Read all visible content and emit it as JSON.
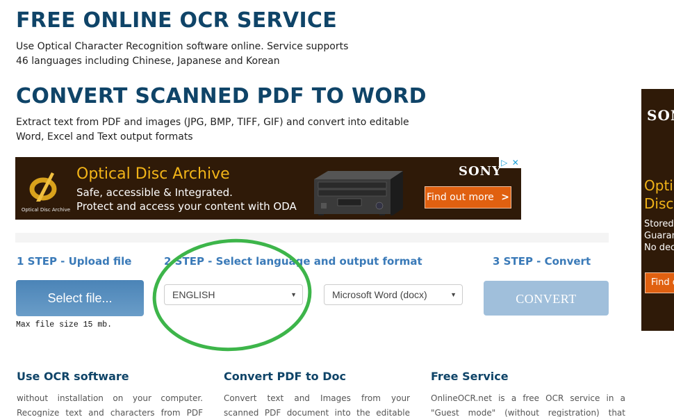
{
  "header": {
    "title": "FREE ONLINE OCR SERVICE",
    "description_lines": [
      "Use Optical Character Recognition software online. Service supports",
      "46 languages including Chinese, Japanese and Korean"
    ],
    "subtitle": "CONVERT SCANNED PDF TO WORD",
    "subdescription_lines": [
      "Extract text from PDF and images (JPG, BMP, TIFF, GIF) and convert into editable",
      "Word, Excel and Text output formats"
    ]
  },
  "ad_banner": {
    "logo_text": "Optical Disc Archive",
    "title": "Optical Disc Archive",
    "line1": "Safe, accessible & Integrated.",
    "line2": "Protect and access your content with ODA",
    "brand": "SONY",
    "cta": "Find out more",
    "cta_chevron": ">",
    "adchoices_play": "▷",
    "adchoices_close": "✕",
    "colors": {
      "background": "#2f1a08",
      "title": "#f2b418",
      "cta": "#e06010"
    }
  },
  "side_ad": {
    "brand": "SONY",
    "title_lines": [
      "Optical",
      "Disc"
    ],
    "lines": [
      "Stored",
      "Guaranteed",
      "No decay"
    ],
    "cta": "Find out more"
  },
  "steps": {
    "step1_label": "1 STEP - Upload file",
    "step2_label": "2 STEP - Select language and output format",
    "step3_label": "3 STEP - Convert",
    "select_file_button": "Select file...",
    "max_size_note": "Max file size 15 mb.",
    "language_select": {
      "value": "ENGLISH"
    },
    "format_select": {
      "value": "Microsoft Word (docx)"
    },
    "convert_button": "CONVERT",
    "caret": "▼",
    "colors": {
      "step_label": "#3a7ab8",
      "select_button": "#5b92c2",
      "convert_button": "#a0bfdb",
      "highlight_ring": "#3db54a"
    }
  },
  "features": [
    {
      "title": "Use OCR software",
      "text_lines": [
        "without installation on your computer.",
        "Recognize text and characters from PDF"
      ]
    },
    {
      "title": "Convert PDF to Doc",
      "text_lines": [
        "Convert text and Images from your",
        "scanned PDF document into the editable"
      ]
    },
    {
      "title": "Free Service",
      "text_lines": [
        "OnlineOCR.net is a free OCR service in a",
        "\"Guest mode\" (without registration) that"
      ]
    }
  ]
}
